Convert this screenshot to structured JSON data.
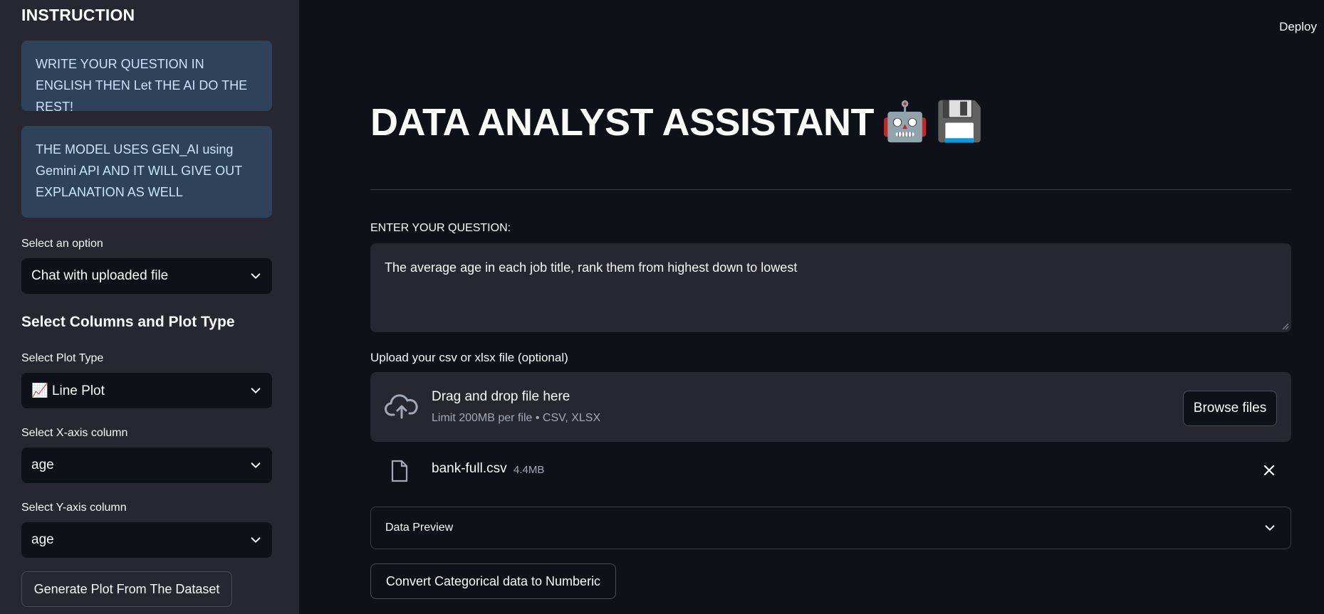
{
  "sidebar": {
    "title": "INSTRUCTION",
    "info_1": "WRITE YOUR QUESTION IN ENGLISH THEN Let THE AI DO THE REST!",
    "info_2": "THE MODEL USES GEN_AI using Gemini API AND IT WILL GIVE OUT EXPLANATION AS WELL",
    "option_label": "Select an option",
    "option_value": "Chat with uploaded file",
    "columns_heading": "Select Columns and Plot Type",
    "plot_type_label": "Select Plot Type",
    "plot_type_icon": "📈",
    "plot_type_value": "Line Plot",
    "x_label": "Select X-axis column",
    "x_value": "age",
    "y_label": "Select Y-axis column",
    "y_value": "age",
    "generate_button": "Generate Plot From The Dataset"
  },
  "header": {
    "deploy": "Deploy"
  },
  "main": {
    "title": "DATA ANALYST ASSISTANT",
    "title_emoji_1": "🤖",
    "title_emoji_2": "💾",
    "question_label": "ENTER YOUR QUESTION:",
    "question_value": "The average age in each job title, rank them from highest down to lowest",
    "upload_label": "Upload your csv or xlsx file (optional)",
    "dropzone_title": "Drag and drop file here",
    "dropzone_sub": "Limit 200MB per file • CSV, XLSX",
    "browse_button": "Browse files",
    "file_name": "bank-full.csv",
    "file_size": "4.4MB",
    "expander_label": "Data Preview",
    "convert_button": "Convert Categorical data to Numberic"
  },
  "colors": {
    "background": "#0e1117",
    "sidebar": "#262730",
    "info_bg": "#2e4359",
    "info_text": "#c9e3fb"
  }
}
